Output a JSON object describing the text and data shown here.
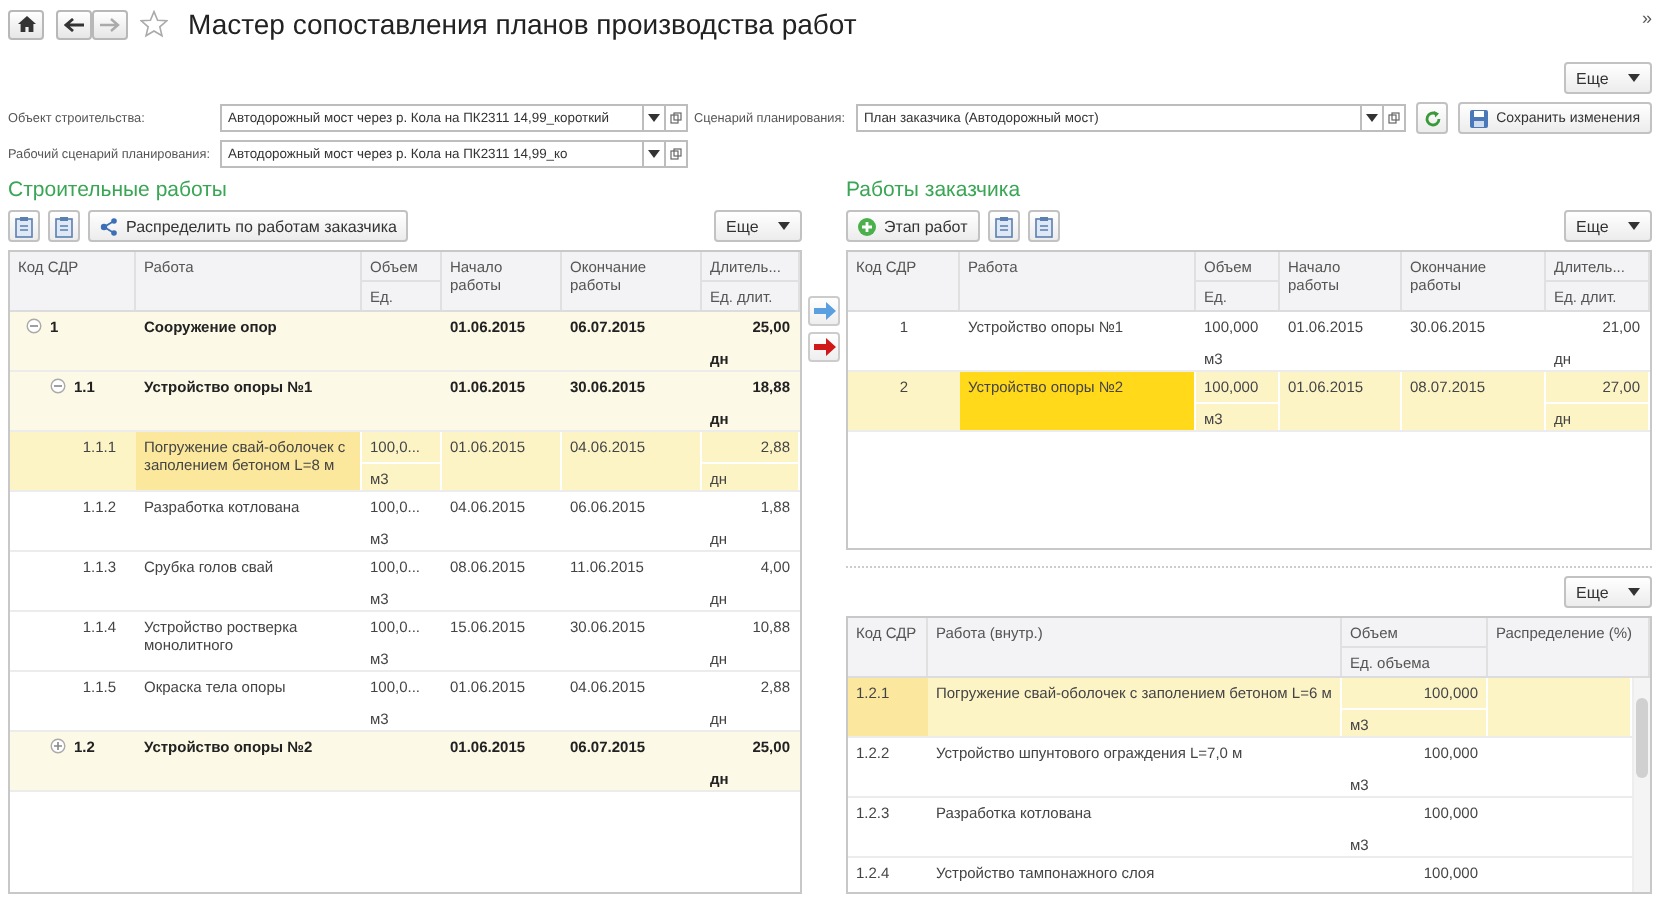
{
  "header": {
    "title": "Мастер сопоставления планов производства работ",
    "favorite": false,
    "panel_toggle": "»"
  },
  "top_more_button": "Еще",
  "fields": [
    {
      "label": "Объект строительства:",
      "value": "Автодорожный мост через р. Кола на ПК2311 14,99_короткий"
    },
    {
      "label": "Рабочий сценарий планирования:",
      "value": "Автодорожный мост через р. Кола на ПК2311 14,99_ко"
    }
  ],
  "scenario_field": {
    "label": "Сценарий планирования:",
    "value": "План заказчика (Автодорожный мост)"
  },
  "save_button": "Сохранить изменения",
  "construction_works": {
    "title": "Строительные работы",
    "distribute_button": "Распределить по работам заказчика",
    "more_button": "Еще",
    "columns": [
      {
        "label": "Код СДР"
      },
      {
        "label": "Работа"
      },
      {
        "label": "Объем",
        "sub": "Ед."
      },
      {
        "label": "Начало работы"
      },
      {
        "label": "Окончание работы"
      },
      {
        "label": "Длитель...",
        "sub": "Ед. длит."
      }
    ],
    "rows": [
      {
        "kind": "group",
        "code": "1",
        "name": "Сооружение опор",
        "start": "01.06.2015",
        "end": "06.07.2015",
        "duration": "25,00",
        "duration_unit": "дн",
        "expanded": true,
        "selected": false,
        "children": [
          {
            "kind": "group",
            "code": "1.1",
            "name": "Устройство опоры №1",
            "start": "01.06.2015",
            "end": "30.06.2015",
            "duration": "18,88",
            "duration_unit": "дн",
            "expanded": true,
            "selected": false,
            "children": [
              {
                "kind": "work",
                "code": "1.1.1",
                "name": "Погружение свай-оболочек с заполением бетоном L=8 м",
                "volume": "100,0...",
                "unit": "м3",
                "start": "01.06.2015",
                "end": "04.06.2015",
                "duration": "2,88",
                "duration_unit": "дн",
                "selected": true
              },
              {
                "kind": "work",
                "code": "1.1.2",
                "name": "Разработка котлована",
                "volume": "100,0...",
                "unit": "м3",
                "start": "04.06.2015",
                "end": "06.06.2015",
                "duration": "1,88",
                "duration_unit": "дн",
                "selected": false
              },
              {
                "kind": "work",
                "code": "1.1.3",
                "name": "Срубка голов свай",
                "volume": "100,0...",
                "unit": "м3",
                "start": "08.06.2015",
                "end": "11.06.2015",
                "duration": "4,00",
                "duration_unit": "дн",
                "selected": false
              },
              {
                "kind": "work",
                "code": "1.1.4",
                "name": "Устройство ростверка монолитного",
                "volume": "100,0...",
                "unit": "м3",
                "start": "15.06.2015",
                "end": "30.06.2015",
                "duration": "10,88",
                "duration_unit": "дн",
                "selected": false
              },
              {
                "kind": "work",
                "code": "1.1.5",
                "name": "Окраска тела опоры",
                "volume": "100,0...",
                "unit": "м3",
                "start": "01.06.2015",
                "end": "04.06.2015",
                "duration": "2,88",
                "duration_unit": "дн",
                "selected": false
              }
            ]
          },
          {
            "kind": "group",
            "code": "1.2",
            "name": "Устройство опоры №2",
            "start": "01.06.2015",
            "end": "06.07.2015",
            "duration": "25,00",
            "duration_unit": "дн",
            "expanded": false,
            "selected": false
          }
        ]
      }
    ]
  },
  "customer_works": {
    "title": "Работы заказчика",
    "stage_button": "Этап работ",
    "more_button": "Еще",
    "columns": [
      {
        "label": "Код СДР"
      },
      {
        "label": "Работа"
      },
      {
        "label": "Объем",
        "sub": "Ед."
      },
      {
        "label": "Начало работы"
      },
      {
        "label": "Окончание работы"
      },
      {
        "label": "Длитель...",
        "sub": "Ед. длит."
      }
    ],
    "rows": [
      {
        "code": "1",
        "name": "Устройство опоры №1",
        "volume": "100,000",
        "unit": "м3",
        "start": "01.06.2015",
        "end": "30.06.2015",
        "duration": "21,00",
        "duration_unit": "дн",
        "selected": false
      },
      {
        "code": "2",
        "name": "Устройство опоры №2",
        "volume": "100,000",
        "unit": "м3",
        "start": "01.06.2015",
        "end": "08.07.2015",
        "duration": "27,00",
        "duration_unit": "дн",
        "selected": true
      }
    ]
  },
  "distribution": {
    "more_button": "Еще",
    "columns": [
      {
        "label": "Код СДР"
      },
      {
        "label": "Работа (внутр.)"
      },
      {
        "label": "Объем",
        "sub": "Ед. объема"
      },
      {
        "label": "Распределение (%)"
      }
    ],
    "rows": [
      {
        "code": "1.2.1",
        "name": "Погружение свай-оболочек с заполением бетоном L=6 м",
        "volume": "100,000",
        "unit": "м3",
        "selected": true
      },
      {
        "code": "1.2.2",
        "name": "Устройство шпунтового ограждения L=7,0 м",
        "volume": "100,000",
        "unit": "м3",
        "selected": false
      },
      {
        "code": "1.2.3",
        "name": "Разработка котлована",
        "volume": "100,000",
        "unit": "м3",
        "selected": false
      },
      {
        "code": "1.2.4",
        "name": "Устройство тампонажного слоя",
        "volume": "100,000",
        "selected": false
      }
    ]
  }
}
